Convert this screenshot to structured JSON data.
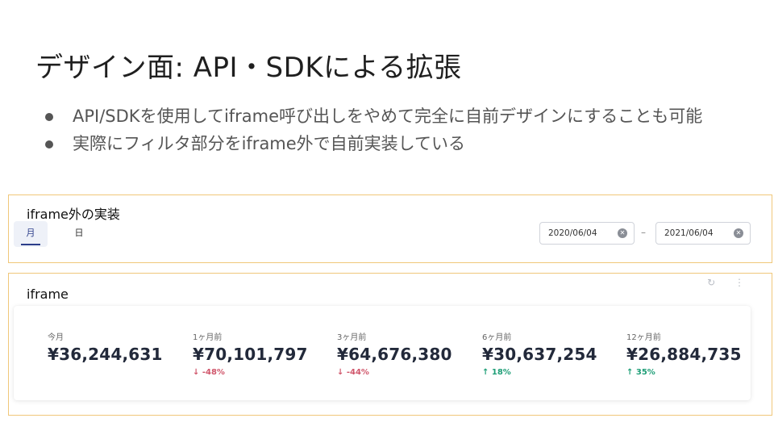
{
  "slide": {
    "title": "デザイン面: API・SDKによる拡張",
    "bullets": [
      "API/SDKを使用してiframe呼び出しをやめて完全に自前デザインにすることも可能",
      "実際にフィルタ部分をiframe外で自前実装している"
    ]
  },
  "outer": {
    "label": "iframe外の実装",
    "tabs": [
      "月",
      "日"
    ],
    "date_start": "2020/06/04",
    "date_end": "2021/06/04",
    "date_separator": "–",
    "clear_glyph": "✕"
  },
  "iframe": {
    "label": "iframe",
    "refresh_icon": "↻",
    "more_icon": "⋮",
    "kpis": [
      {
        "label": "今月",
        "value": "¥36,244,631",
        "change": "",
        "direction": ""
      },
      {
        "label": "1ヶ月前",
        "value": "¥70,101,797",
        "change": "↓ -48%",
        "direction": "down"
      },
      {
        "label": "3ヶ月前",
        "value": "¥64,676,380",
        "change": "↓ -44%",
        "direction": "down"
      },
      {
        "label": "6ヶ月前",
        "value": "¥30,637,254",
        "change": "↑ 18%",
        "direction": "up"
      },
      {
        "label": "12ヶ月前",
        "value": "¥26,884,735",
        "change": "↑ 35%",
        "direction": "up"
      }
    ]
  },
  "colors": {
    "frame_border": "#f0c77a",
    "down": "#d0566b",
    "up": "#1e9e77",
    "active_tab": "#2c3e8a"
  }
}
